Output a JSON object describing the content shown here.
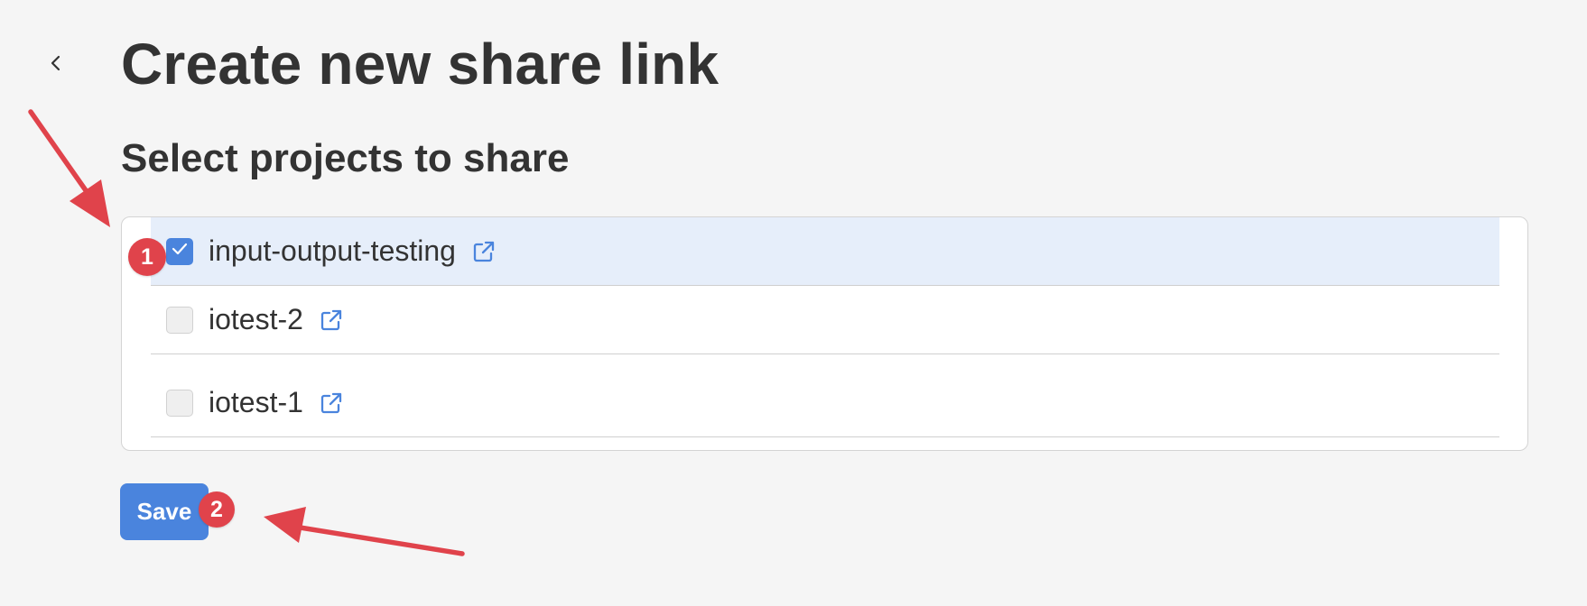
{
  "page": {
    "title": "Create new share link",
    "section_title": "Select projects to share"
  },
  "projects": [
    {
      "name": "input-output-testing",
      "checked": true
    },
    {
      "name": "iotest-2",
      "checked": false
    },
    {
      "name": "iotest-1",
      "checked": false
    }
  ],
  "actions": {
    "save_label": "Save"
  },
  "annotations": {
    "step_1": "1",
    "step_2": "2"
  },
  "icons": {
    "back": "chevron-left-icon",
    "checkbox_check": "checkmark-icon",
    "project_link": "external-link-icon",
    "pointer": "arrow-annotation-icon"
  },
  "colors": {
    "accent": "#4a84dd",
    "selected_row": "#e6eefa",
    "annotation": "#e0434b",
    "background": "#f5f5f5",
    "text": "#333333"
  }
}
